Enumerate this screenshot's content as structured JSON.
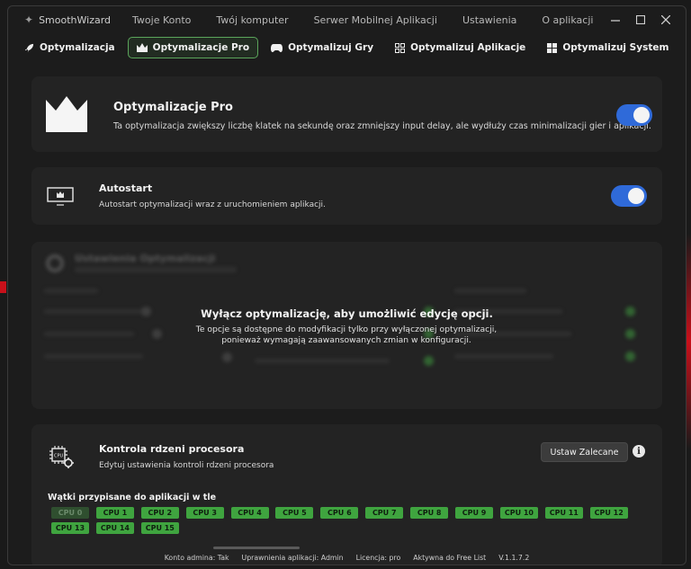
{
  "app": {
    "name": "SmoothWizard",
    "menu": [
      "Twoje Konto",
      "Twój komputer",
      "Serwer Mobilnej Aplikacji",
      "Ustawienia",
      "O aplikacji"
    ]
  },
  "tabs": [
    {
      "label": "Optymalizacja"
    },
    {
      "label": "Optymalizacje Pro"
    },
    {
      "label": "Optymalizuj Gry"
    },
    {
      "label": "Optymalizuj Aplikacje"
    },
    {
      "label": "Optymalizuj System"
    }
  ],
  "pro": {
    "title": "Optymalizacje Pro",
    "desc": "Ta optymalizacja zwiększy liczbę klatek na sekundę oraz zmniejszy input delay, ale wydłuży czas minimalizacji gier i aplikacji.",
    "enabled": true
  },
  "autostart": {
    "title": "Autostart",
    "desc": "Autostart optymalizacji wraz z uruchomieniem aplikacji.",
    "enabled": true
  },
  "settings_locked": {
    "title": "Ustawienia Optymalizacji",
    "overlay_title": "Wyłącz optymalizację, aby umożliwić edycję opcji.",
    "overlay_desc": "Te opcje są dostępne do modyfikacji tylko przy wyłączonej optymalizacji, ponieważ wymagają zaawansowanych zmian w konfiguracji."
  },
  "cpu": {
    "title": "Kontrola rdzeni procesora",
    "desc": "Edytuj ustawienia kontroli rdzeni procesora",
    "recommend_button": "Ustaw Zalecane",
    "threads_label": "Wątki przypisane do aplikacji w tle",
    "cores": [
      {
        "label": "CPU 0",
        "active": false
      },
      {
        "label": "CPU 1",
        "active": true
      },
      {
        "label": "CPU 2",
        "active": true
      },
      {
        "label": "CPU 3",
        "active": true
      },
      {
        "label": "CPU 4",
        "active": true
      },
      {
        "label": "CPU 5",
        "active": true
      },
      {
        "label": "CPU 6",
        "active": true
      },
      {
        "label": "CPU 7",
        "active": true
      },
      {
        "label": "CPU 8",
        "active": true
      },
      {
        "label": "CPU 9",
        "active": true
      },
      {
        "label": "CPU 10",
        "active": true
      },
      {
        "label": "CPU 11",
        "active": true
      },
      {
        "label": "CPU 12",
        "active": true
      },
      {
        "label": "CPU 13",
        "active": true
      },
      {
        "label": "CPU 14",
        "active": true
      },
      {
        "label": "CPU 15",
        "active": true
      }
    ]
  },
  "status": {
    "admin": "Konto admina: Tak",
    "permissions": "Uprawnienia aplikacji: Admin",
    "license": "Licencja: pro",
    "freelist": "Aktywna do Free List",
    "version": "V.1.1.7.2"
  },
  "colors": {
    "accent_green": "#5ba55b",
    "toggle_blue": "#2f6ad9",
    "cpu_green": "#3fa43f"
  }
}
